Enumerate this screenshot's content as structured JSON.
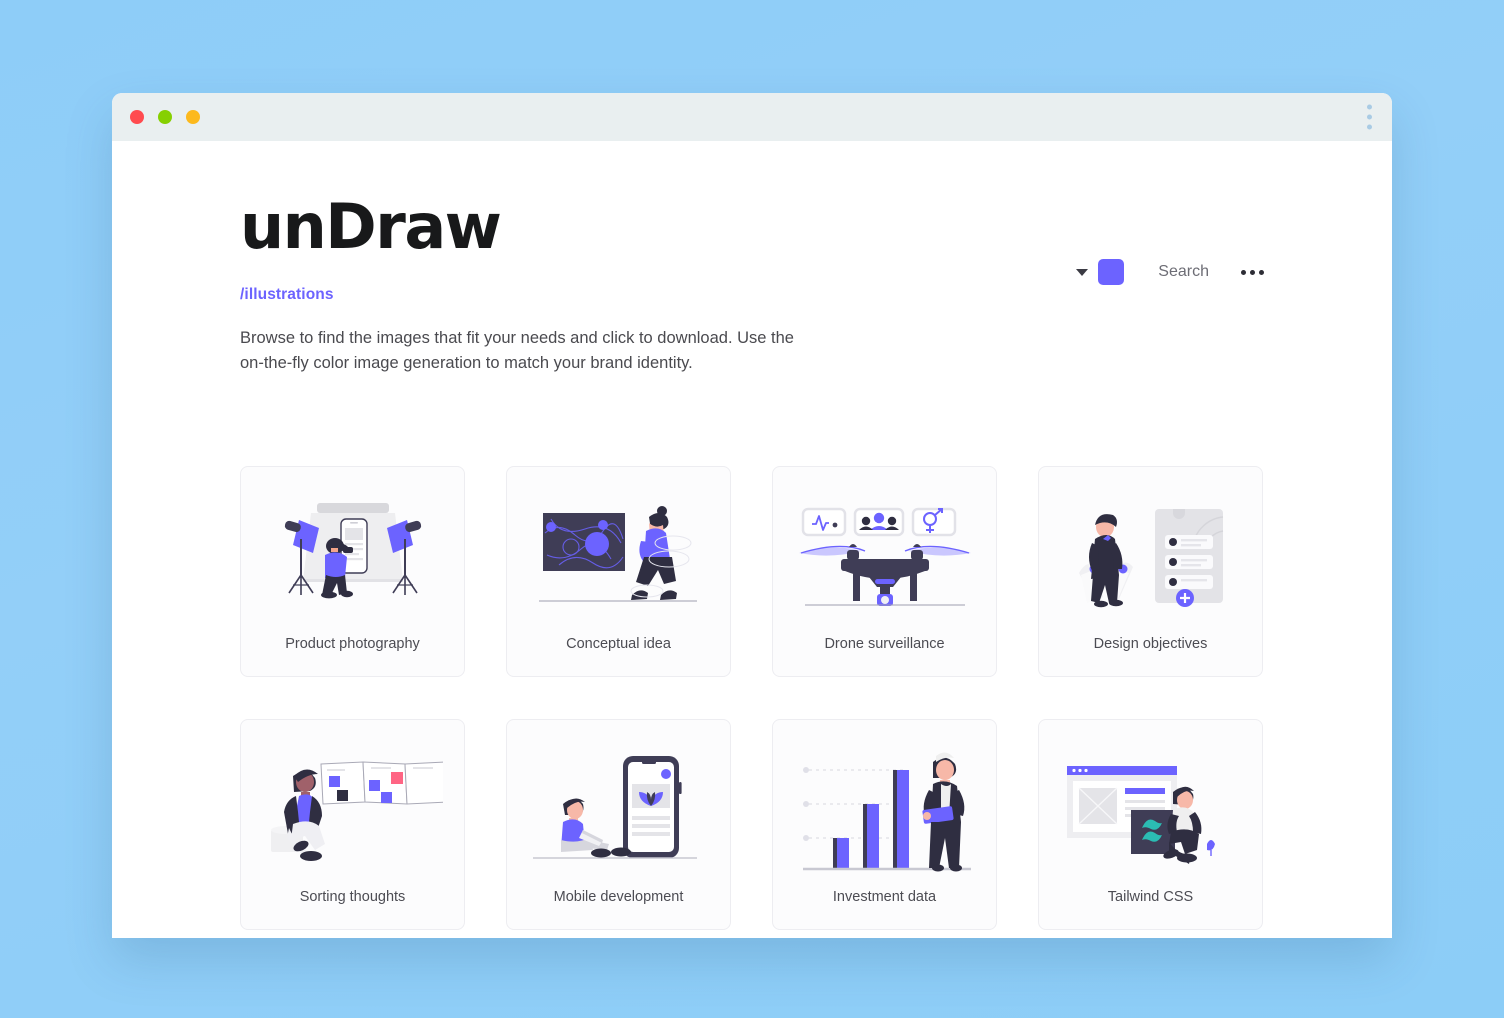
{
  "window": {
    "traffic_lights": [
      {
        "name": "close",
        "color": "#ff4b4f"
      },
      {
        "name": "minimize",
        "color": "#86d001"
      },
      {
        "name": "maximize",
        "color": "#fcb91d"
      }
    ],
    "menu_icon": "kebab-vertical-icon"
  },
  "header": {
    "brand": "unDraw",
    "slug": "/illustrations",
    "description": "Browse to find the images that fit your needs and click to download. Use the on-the-fly color image generation to match your brand identity.",
    "color_picker": {
      "caret_icon": "chevron-down-icon",
      "swatch_color": "#6c63ff"
    },
    "search_placeholder": "Search",
    "overflow_icon": "ellipsis-horizontal-icon"
  },
  "theme": {
    "page_background": "#8ecdf8",
    "titlebar_background": "#e9eff0",
    "accent": "#6c63ff",
    "card_background": "#fcfcfd",
    "card_border": "#ededf1",
    "text_primary": "#18191a",
    "text_secondary": "#4a4a4f",
    "ink_dark": "#3f3d56",
    "tailwind_teal": "#2bbcb3"
  },
  "illustrations": [
    {
      "id": "product-photography",
      "label": "Product photography"
    },
    {
      "id": "conceptual-idea",
      "label": "Conceptual idea"
    },
    {
      "id": "drone-surveillance",
      "label": "Drone surveillance"
    },
    {
      "id": "design-objectives",
      "label": "Design objectives"
    },
    {
      "id": "sorting-thoughts",
      "label": "Sorting thoughts"
    },
    {
      "id": "mobile-development",
      "label": "Mobile development"
    },
    {
      "id": "investment-data",
      "label": "Investment data"
    },
    {
      "id": "tailwind-css",
      "label": "Tailwind CSS"
    }
  ]
}
